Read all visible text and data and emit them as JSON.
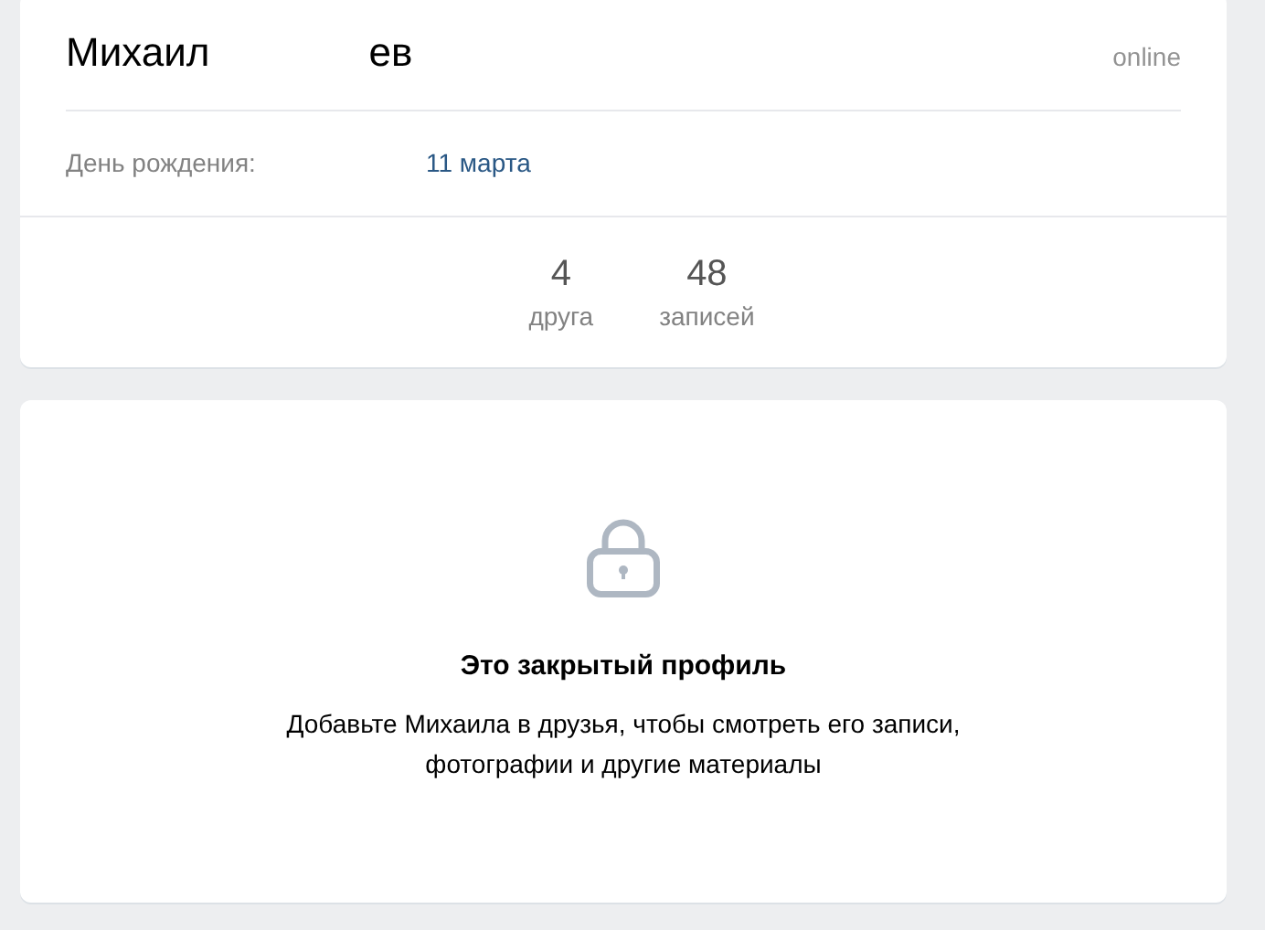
{
  "profile": {
    "name_parts": [
      "Михаил",
      "ев"
    ],
    "status": "online",
    "info": [
      {
        "label": "День рождения:",
        "value": "11 марта"
      }
    ],
    "counters": [
      {
        "count": "4",
        "label": "друга"
      },
      {
        "count": "48",
        "label": "записей"
      }
    ]
  },
  "closed_notice": {
    "title": "Это закрытый профиль",
    "lines": [
      "Добавьте Михаила в друзья, чтобы смотреть его записи,",
      "фотографии и другие материалы"
    ]
  }
}
